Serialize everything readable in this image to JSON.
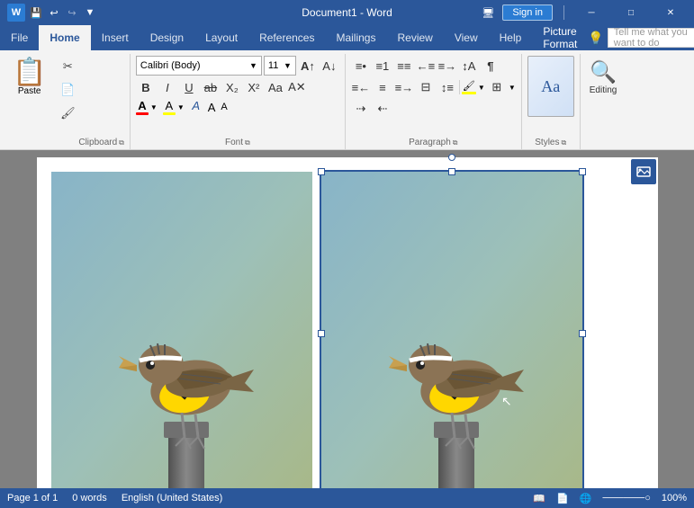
{
  "titlebar": {
    "doc_name": "Document1 - Word",
    "app_name": "Word",
    "sign_in": "Sign in",
    "minimize": "─",
    "maximize": "□",
    "close": "✕",
    "qat": [
      "💾",
      "↩",
      "↪",
      "▼"
    ]
  },
  "ribbon": {
    "tabs": [
      "File",
      "Home",
      "Insert",
      "Design",
      "Layout",
      "References",
      "Mailings",
      "Review",
      "View",
      "Help",
      "Picture Format"
    ],
    "active_tab": "Home",
    "groups": {
      "clipboard": {
        "label": "Clipboard",
        "paste": "Paste"
      },
      "font": {
        "label": "Font",
        "name": "Calibri (Body)",
        "size": "11"
      },
      "paragraph": {
        "label": "Paragraph"
      },
      "styles": {
        "label": "Styles",
        "btn": "Styles"
      },
      "editing": {
        "label": "Editing",
        "btn": "Editing"
      }
    }
  },
  "tell_me": {
    "placeholder": "Tell me what you want to do"
  },
  "document": {
    "images": [
      {
        "id": "img1",
        "selected": false
      },
      {
        "id": "img2",
        "selected": true
      }
    ]
  },
  "statusbar": {
    "page": "Page 1 of 1",
    "words": "0 words",
    "lang": "English (United States)"
  }
}
